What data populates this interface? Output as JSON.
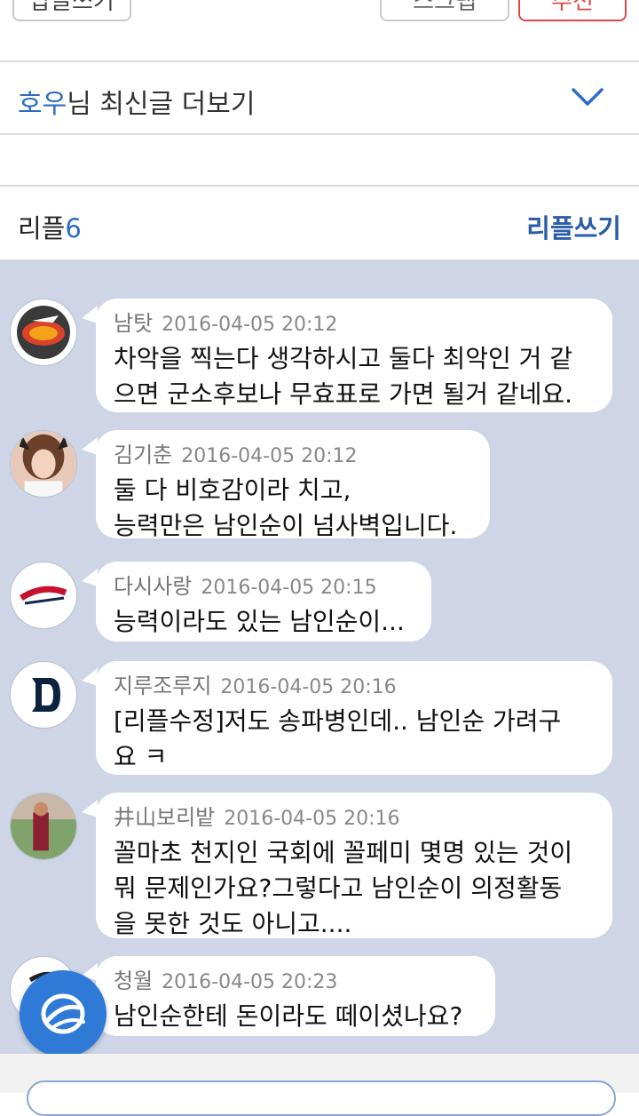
{
  "top_buttons": {
    "write": "답글쓰기",
    "scrap": "스크랩",
    "recommend": "추천"
  },
  "more_posts": {
    "nick": "호우",
    "label": "님 최신글 더보기"
  },
  "replies": {
    "label": "리플",
    "count": "6",
    "write": "리플쓰기"
  },
  "comments": [
    {
      "name": "남탓",
      "date": "2016-04-05 20:12",
      "text": "차악을 찍는다 생각하시고 둘다 최악인 거 같\n으면 군소후보나 무효표로 가면 될거 같네요.",
      "avatar": "team-logo-icon"
    },
    {
      "name": "김기춘",
      "date": "2016-04-05 20:12",
      "text": "둘 다 비호감이라 치고,\n능력만은 남인순이 넘사벽입니다.",
      "avatar": "photo-avatar"
    },
    {
      "name": "다시사랑",
      "date": "2016-04-05 20:15",
      "text": "능력이라도 있는 남인순이...",
      "avatar": "braves-logo-icon"
    },
    {
      "name": "지루조루지",
      "date": "2016-04-05 20:16",
      "text": "[리플수정]저도 송파병인데.. 남인순 가려구\n요 ㅋ",
      "avatar": "tigers-logo-icon"
    },
    {
      "name": "井山보리밭",
      "date": "2016-04-05 20:16",
      "text": "꼴마초 천지인 국회에 꼴페미 몇명 있는 것이\n뭐 문제인가요?그렇다고 남인순이 의정활동\n을 못한 것도 아니고....",
      "avatar": "photo-avatar"
    },
    {
      "name": "청월",
      "date": "2016-04-05 20:23",
      "text": "남인순한테 돈이라도 떼이셨나요?",
      "avatar": "team-logo-icon"
    }
  ],
  "colors": {
    "accent": "#2b6cc4",
    "comment_bg": "#cdd5e6",
    "fab": "#2e7ad6",
    "recommend": "#e04848"
  }
}
